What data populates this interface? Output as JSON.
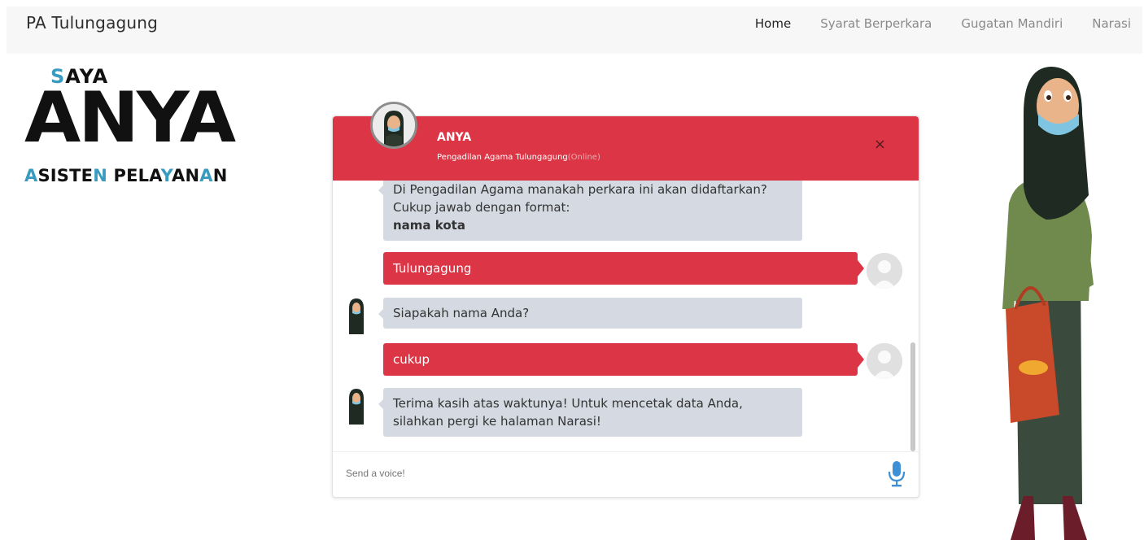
{
  "navbar": {
    "brand": "PA Tulungagung",
    "links": [
      "Home",
      "Syarat Berperkara",
      "Gugatan Mandiri",
      "Narasi"
    ]
  },
  "logo": {
    "saya_first": "S",
    "saya_rest": "AYA",
    "anya": "ANYA",
    "sub_parts": [
      "A",
      "SISTE",
      "N",
      " PELA",
      "Y",
      "AN",
      "A",
      "N"
    ]
  },
  "chat": {
    "header": {
      "name": "ANYA",
      "subtitle": "Pengadilan Agama Tulungagung",
      "status": "(Online)",
      "close": "×"
    },
    "messages": [
      {
        "from": "bot",
        "lines": [
          "Di Pengadilan Agama manakah perkara ini akan didaftarkan?",
          "Cukup jawab dengan format:"
        ],
        "bold": "nama kota"
      },
      {
        "from": "user",
        "text": "Tulungagung"
      },
      {
        "from": "bot",
        "text": "Siapakah nama Anda?"
      },
      {
        "from": "user",
        "text": "cukup"
      },
      {
        "from": "bot",
        "text": "Terima kasih atas waktunya! Untuk mencetak data Anda, silahkan pergi ke halaman Narasi!"
      }
    ],
    "input_placeholder": "Send a voice!"
  },
  "colors": {
    "accent": "#dc3545",
    "bot_bubble": "#d4d9e2",
    "logo_blue": "#3a9bc0"
  },
  "icons": {
    "close": "close-icon",
    "mic": "microphone-icon"
  }
}
